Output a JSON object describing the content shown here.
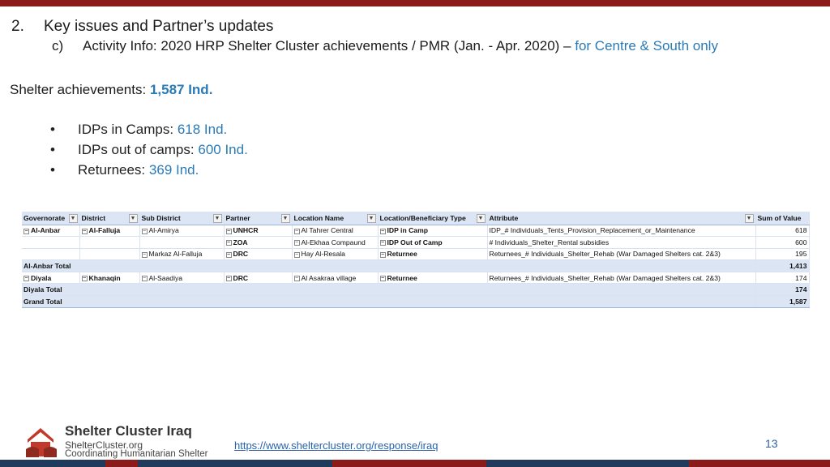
{
  "header": {
    "num": "2.",
    "title": "Key issues and Partner’s updates",
    "sub_label": "c)",
    "sub_text": "Activity Info: 2020 HRP Shelter Cluster achievements / PMR (Jan. - Apr. 2020) –",
    "sub_accent": "for Centre & South only"
  },
  "achievements": {
    "label": "Shelter achievements:",
    "value": "1,587 Ind."
  },
  "bullets": [
    {
      "dot": "•",
      "label": "IDPs in Camps:",
      "value": "618 Ind."
    },
    {
      "dot": "•",
      "label": "IDPs out of camps:",
      "value": "600 Ind."
    },
    {
      "dot": "•",
      "label": "Returnees:",
      "value": "369 Ind."
    }
  ],
  "table": {
    "headers": [
      "Governorate",
      "District",
      "Sub District",
      "Partner",
      "Location Name",
      "Location/Beneficiary Type",
      "Attribute",
      "Sum of Value"
    ],
    "rows": [
      {
        "gov": "Al-Anbar",
        "district": "Al-Falluja",
        "subdistrict": "Al-Amirya",
        "partner": "UNHCR",
        "location": "Al Tahrer Central",
        "type": "IDP in Camp",
        "attribute": "IDP_# Individuals_Tents_Provision_Replacement_or_Maintenance",
        "value": "618"
      },
      {
        "gov": "",
        "district": "",
        "subdistrict": "",
        "partner": "ZOA",
        "location": "Al-Ekhaa Compaund",
        "type": "IDP Out of Camp",
        "attribute": "# Individuals_Shelter_Rental subsidies",
        "value": "600"
      },
      {
        "gov": "",
        "district": "",
        "subdistrict": "Markaz Al-Falluja",
        "partner": "DRC",
        "location": "Hay Al-Resala",
        "type": "Returnee",
        "attribute": "Returnees_# Individuals_Shelter_Rehab (War Damaged Shelters cat. 2&3)",
        "value": "195"
      }
    ],
    "anbar_total": {
      "label": "Al-Anbar Total",
      "value": "1,413"
    },
    "diyala_row": {
      "gov": "Diyala",
      "district": "Khanaqin",
      "subdistrict": "Al-Saadiya",
      "partner": "DRC",
      "location": "Al Asakraa village",
      "type": "Returnee",
      "attribute": "Returnees_# Individuals_Shelter_Rehab (War Damaged Shelters cat. 2&3)",
      "value": "174"
    },
    "diyala_total": {
      "label": "Diyala Total",
      "value": "174"
    },
    "grand_total": {
      "label": "Grand Total",
      "value": "1,587"
    },
    "filter_icon": "▼",
    "filtered_icon": "▼",
    "collapse_icon": "−"
  },
  "logo": {
    "title": "Shelter Cluster Iraq",
    "sub1": "ShelterCluster.org",
    "sub2": "Coordinating Humanitarian Shelter",
    "color": "#c0392b"
  },
  "footer": {
    "link": "https://www.sheltercluster.org/response/iraq",
    "page": "13"
  },
  "colors": {
    "top_bar": "#8b1a1a",
    "accent": "#2a7ab5",
    "strip": [
      "#1f3a5a",
      "#8b1a1a",
      "#1f3a5a",
      "#8b1a1a",
      "#1f3a5a",
      "#8b1a1a"
    ]
  }
}
